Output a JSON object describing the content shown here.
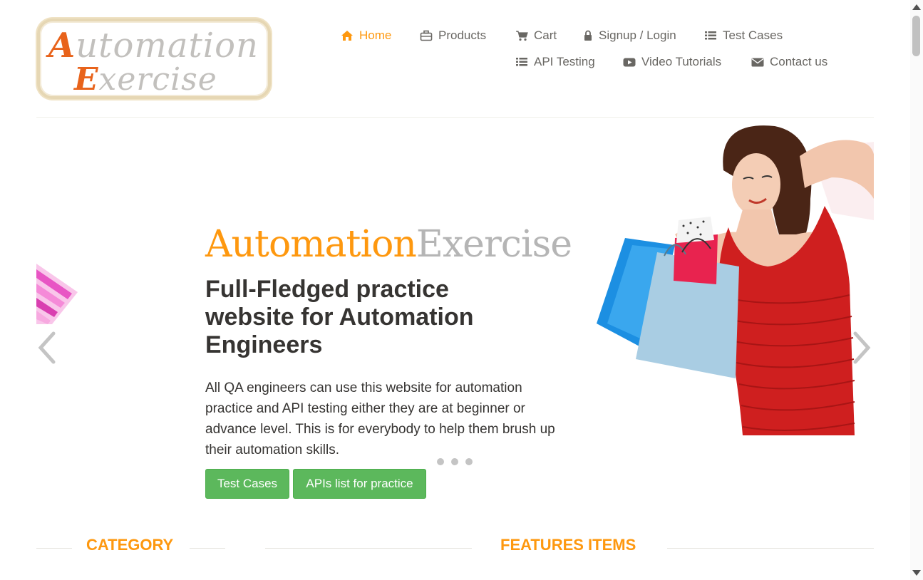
{
  "logo": {
    "line1_cap": "A",
    "line1_rest": "utomation",
    "line2_cap": "E",
    "line2_rest": "xercise"
  },
  "nav": {
    "items": [
      {
        "label": "Home",
        "icon": "home-icon"
      },
      {
        "label": "Products",
        "icon": "briefcase-icon"
      },
      {
        "label": "Cart",
        "icon": "cart-icon"
      },
      {
        "label": "Signup / Login",
        "icon": "lock-icon"
      },
      {
        "label": "Test Cases",
        "icon": "list-icon"
      },
      {
        "label": "API Testing",
        "icon": "list-icon"
      },
      {
        "label": "Video Tutorials",
        "icon": "youtube-play-icon"
      },
      {
        "label": "Contact us",
        "icon": "envelope-icon"
      }
    ]
  },
  "slider": {
    "brand_part1": "Automation",
    "brand_part2": "Exercise",
    "heading": "Full-Fledged practice website for Automation Engineers",
    "text": "All QA engineers can use this website for automation practice and API testing either they are at beginner or advance level. This is for everybody to help them brush up their automation skills.",
    "btn_test_cases": "Test Cases",
    "btn_api_list": "APIs list for practice",
    "indicator_count": 3
  },
  "sections": {
    "category": "CATEGORY",
    "features": "FEATURES ITEMS"
  },
  "colors": {
    "accent": "#fe980f",
    "button_green": "#5cb85c",
    "heading_dark": "#363432",
    "nav_text": "#696763"
  }
}
